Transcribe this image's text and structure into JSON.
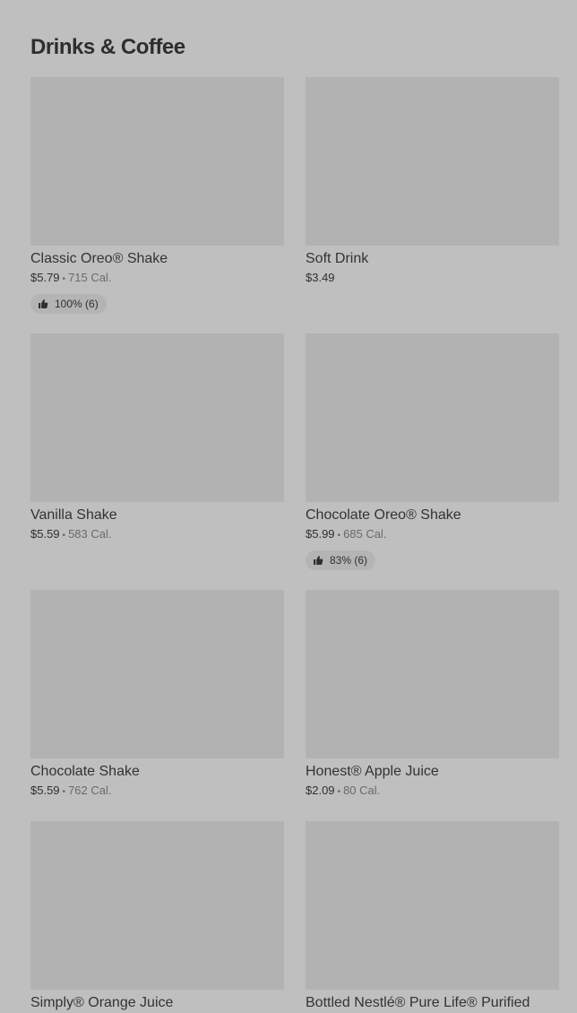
{
  "section": {
    "title": "Drinks & Coffee"
  },
  "items": [
    {
      "title": "Classic Oreo® Shake",
      "price": "$5.79",
      "separator": "•",
      "calories": "715 Cal.",
      "rating": "100% (6)",
      "icon": "thumbs-up-icon"
    },
    {
      "title": "Soft Drink",
      "price": "$3.49"
    },
    {
      "title": "Vanilla Shake",
      "price": "$5.59",
      "separator": "•",
      "calories": "583 Cal."
    },
    {
      "title": "Chocolate Oreo® Shake",
      "price": "$5.99",
      "separator": "•",
      "calories": "685 Cal.",
      "rating": "83% (6)",
      "icon": "thumbs-up-icon"
    },
    {
      "title": "Chocolate Shake",
      "price": "$5.59",
      "separator": "•",
      "calories": "762 Cal."
    },
    {
      "title": "Honest® Apple Juice",
      "price": "$2.09",
      "separator": "•",
      "calories": "80 Cal."
    },
    {
      "title": "Simply® Orange Juice"
    },
    {
      "title": "Bottled Nestlé® Pure Life® Purified"
    }
  ]
}
